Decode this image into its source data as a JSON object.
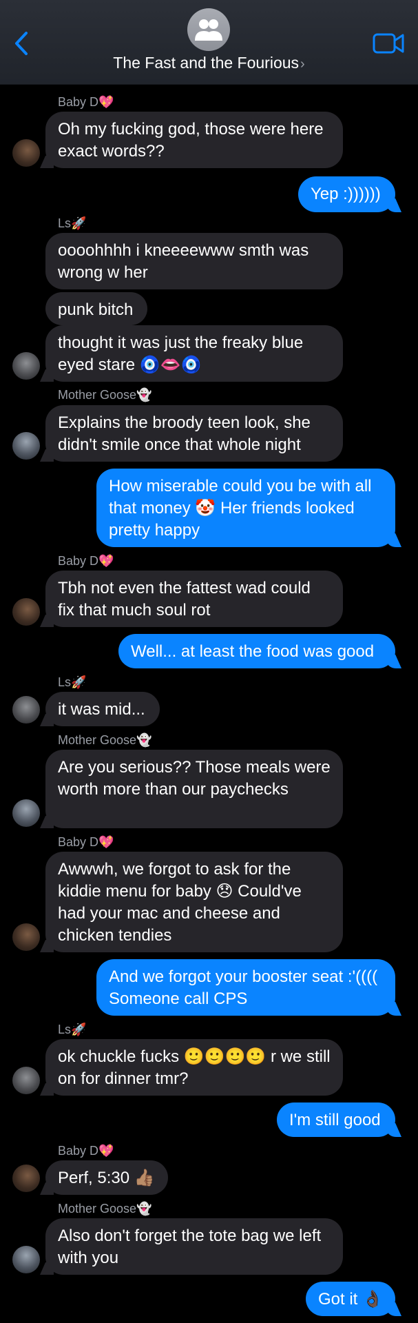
{
  "header": {
    "title": "The Fast and the Fourious",
    "chevron": "›",
    "back_icon": "chevron-left-icon",
    "video_icon": "video-camera-icon",
    "group_icon": "group-people-icon"
  },
  "colors": {
    "background": "#000000",
    "outgoing_bubble": "#0a84ff",
    "incoming_bubble": "#26252a",
    "accent": "#0a84ff"
  },
  "messages": [
    {
      "sender": "Baby D💖",
      "text": "Oh my fucking god, those were here exact words??",
      "direction": "incoming"
    },
    {
      "text": "Yep :))))))",
      "direction": "outgoing"
    },
    {
      "sender": "Ls🚀",
      "text": "oooohhhh i kneeeewww smth was wrong w her",
      "direction": "incoming"
    },
    {
      "text": "punk bitch",
      "direction": "incoming"
    },
    {
      "text": "thought it was just the freaky blue eyed stare 🧿👄🧿",
      "direction": "incoming"
    },
    {
      "sender": "Mother Goose👻",
      "text": "Explains the broody teen look, she didn't smile once that whole night",
      "direction": "incoming"
    },
    {
      "text": "How miserable could you be with all that money 🤡 Her friends looked pretty happy",
      "direction": "outgoing"
    },
    {
      "sender": "Baby D💖",
      "text": "Tbh not even the fattest wad could fix that much soul rot",
      "direction": "incoming"
    },
    {
      "text": "Well... at least the food was good",
      "direction": "outgoing"
    },
    {
      "sender": "Ls🚀",
      "text": "it was mid...",
      "direction": "incoming"
    },
    {
      "sender": "Mother Goose👻",
      "text": "Are you serious?? Those meals were worth more than our paychecks",
      "direction": "incoming"
    },
    {
      "sender": "Baby D💖",
      "text": "Awwwh, we forgot to ask for the kiddie menu for baby 😞 Could've had your mac and cheese and chicken tendies",
      "direction": "incoming"
    },
    {
      "text": "And we forgot your booster seat :'(((( Someone call CPS",
      "direction": "outgoing"
    },
    {
      "sender": "Ls🚀",
      "text": "ok chuckle fucks 🙂🙂🙂🙂 r we still on for dinner tmr?",
      "direction": "incoming"
    },
    {
      "text": "I'm still good",
      "direction": "outgoing"
    },
    {
      "sender": "Baby D💖",
      "text": "Perf, 5:30 👍🏽",
      "direction": "incoming"
    },
    {
      "sender": "Mother Goose👻",
      "text": "Also don't forget the tote bag we left with you",
      "direction": "incoming"
    },
    {
      "text": "Got it 👌🏿",
      "direction": "outgoing"
    }
  ]
}
